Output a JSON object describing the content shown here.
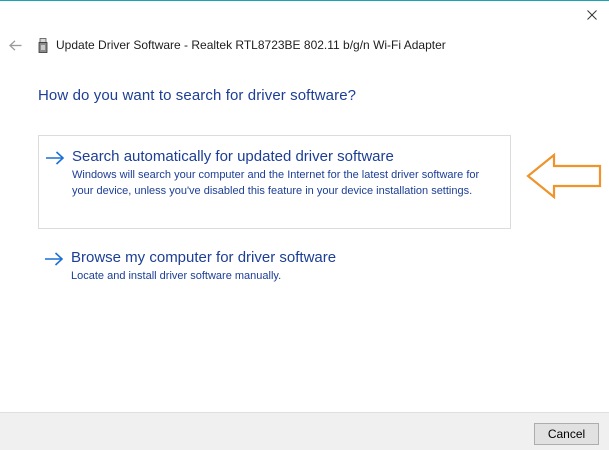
{
  "window": {
    "title": "Update Driver Software - Realtek RTL8723BE 802.11 b/g/n Wi-Fi Adapter",
    "close_icon": "close-icon",
    "back_icon": "back-arrow-icon",
    "device_icon": "network-adapter-icon",
    "accent_color": "#1aa3b5"
  },
  "main": {
    "heading": "How do you want to search for driver software?",
    "options": [
      {
        "icon": "arrow-right-icon",
        "title": "Search automatically for updated driver software",
        "description": "Windows will search your computer and the Internet for the latest driver software for your device, unless you've disabled this feature in your device installation settings."
      },
      {
        "icon": "arrow-right-icon",
        "title": "Browse my computer for driver software",
        "description": "Locate and install driver software manually."
      }
    ],
    "link_color": "#1c3e94",
    "annotation": {
      "icon": "orange-pointer-arrow-icon",
      "color": "#f0932b"
    }
  },
  "footer": {
    "cancel_label": "Cancel"
  }
}
